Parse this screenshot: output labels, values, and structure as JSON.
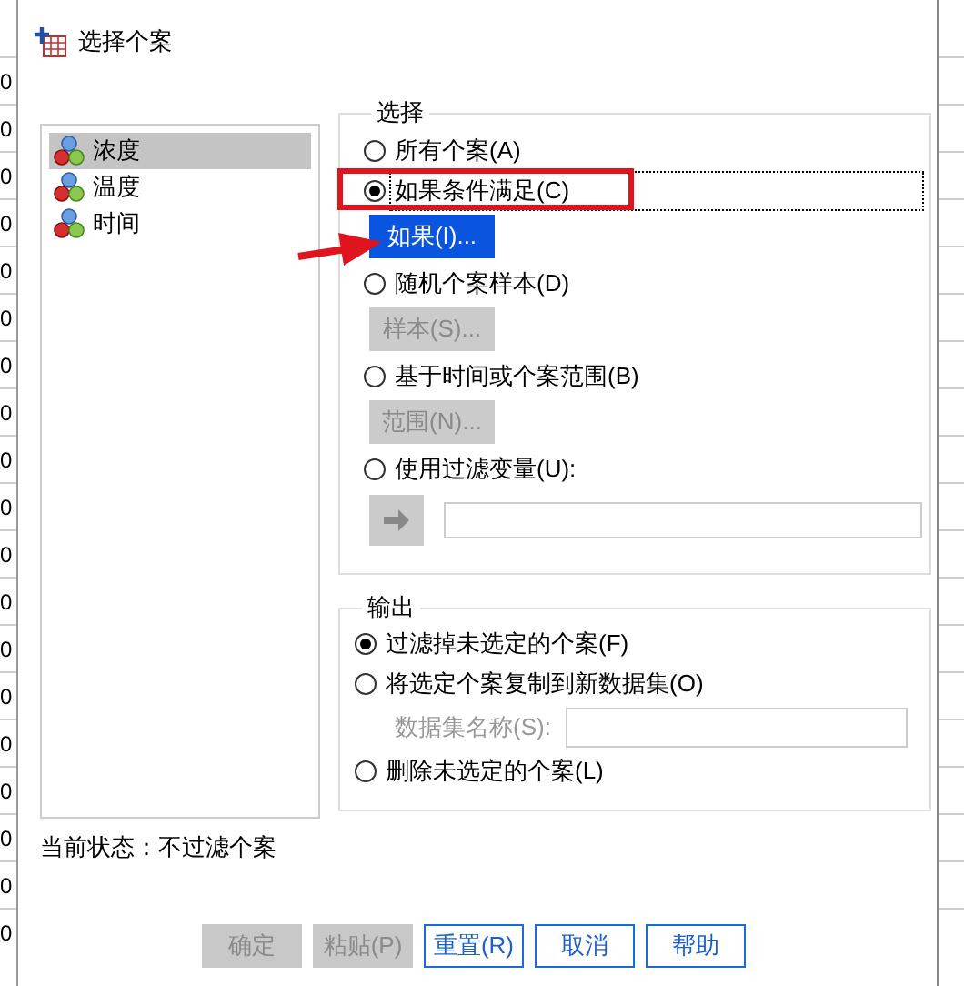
{
  "spreadsheet": {
    "cells": [
      "0",
      "0",
      "0",
      "0",
      "0",
      "0",
      "0",
      "0",
      "0",
      "0",
      "0",
      "0",
      "0",
      "0",
      "0",
      "0",
      "0",
      "0",
      "0"
    ]
  },
  "window": {
    "title": "选择个案"
  },
  "variables": [
    {
      "name": "浓度",
      "selected": true
    },
    {
      "name": "温度",
      "selected": false
    },
    {
      "name": "时间",
      "selected": false
    }
  ],
  "selection": {
    "title": "选择",
    "options": [
      {
        "label": "所有个案(A)",
        "selected": false,
        "focused": false
      },
      {
        "label": "如果条件满足(C)",
        "selected": true,
        "focused": true,
        "sub": {
          "kind": "button",
          "label": "如果(I)...",
          "disabled": false,
          "hovered": true
        }
      },
      {
        "label": "随机个案样本(D)",
        "selected": false,
        "focused": false,
        "sub": {
          "kind": "button",
          "label": "样本(S)...",
          "disabled": true,
          "hovered": false
        }
      },
      {
        "label": "基于时间或个案范围(B)",
        "selected": false,
        "focused": false,
        "sub": {
          "kind": "button",
          "label": "范围(N)...",
          "disabled": true,
          "hovered": false
        }
      },
      {
        "label": "使用过滤变量(U):",
        "selected": false,
        "focused": false,
        "sub": {
          "kind": "variable_picker",
          "disabled": true
        }
      }
    ]
  },
  "output": {
    "title": "输出",
    "options": [
      {
        "label": "过滤掉未选定的个案(F)",
        "selected": true
      },
      {
        "label": "将选定个案复制到新数据集(O)",
        "selected": false,
        "sub": {
          "kind": "name_field",
          "label": "数据集名称(S):",
          "disabled": true
        }
      },
      {
        "label": "删除未选定的个案(L)",
        "selected": false
      }
    ]
  },
  "status": "当前状态：不过滤个案",
  "buttons": [
    {
      "label": "确定",
      "disabled": true
    },
    {
      "label": "粘贴(P)",
      "disabled": true
    },
    {
      "label": "重置(R)",
      "disabled": false
    },
    {
      "label": "取消",
      "disabled": false
    },
    {
      "label": "帮助",
      "disabled": false
    }
  ]
}
